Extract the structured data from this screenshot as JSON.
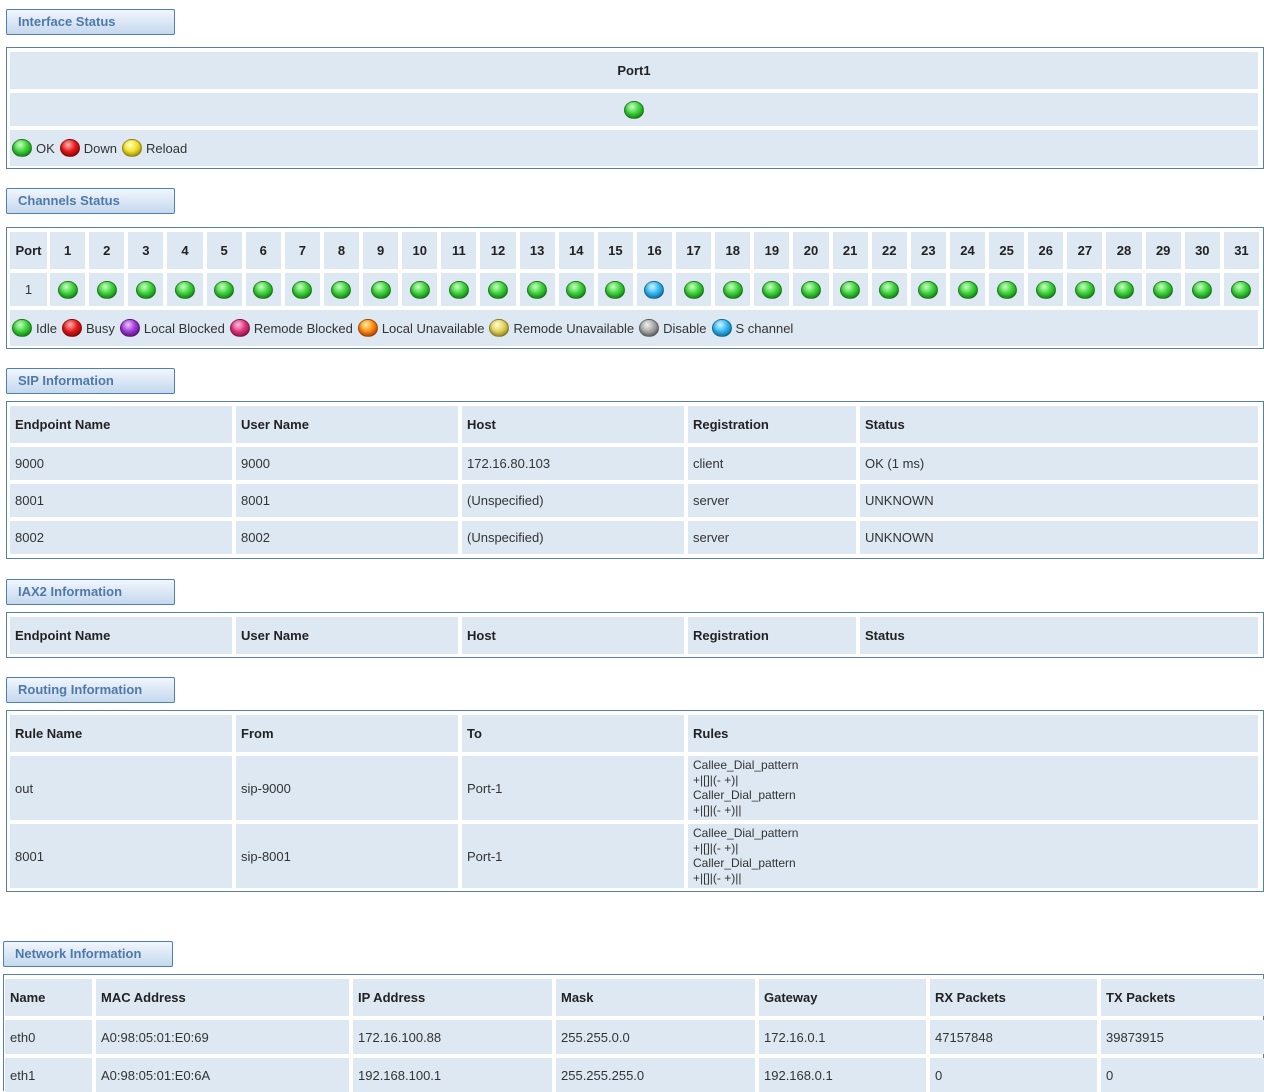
{
  "interface_status": {
    "title": "Interface Status",
    "port_header": "Port1",
    "port_state": "green",
    "legend": [
      {
        "icon": "green",
        "label": "OK"
      },
      {
        "icon": "red",
        "label": "Down"
      },
      {
        "icon": "yellow",
        "label": "Reload"
      }
    ]
  },
  "channels_status": {
    "title": "Channels Status",
    "port_label": "Port",
    "port_value": "1",
    "channels": [
      "1",
      "2",
      "3",
      "4",
      "5",
      "6",
      "7",
      "8",
      "9",
      "10",
      "11",
      "12",
      "13",
      "14",
      "15",
      "16",
      "17",
      "18",
      "19",
      "20",
      "21",
      "22",
      "23",
      "24",
      "25",
      "26",
      "27",
      "28",
      "29",
      "30",
      "31"
    ],
    "states": [
      "green",
      "green",
      "green",
      "green",
      "green",
      "green",
      "green",
      "green",
      "green",
      "green",
      "green",
      "green",
      "green",
      "green",
      "green",
      "cyan",
      "green",
      "green",
      "green",
      "green",
      "green",
      "green",
      "green",
      "green",
      "green",
      "green",
      "green",
      "green",
      "green",
      "green",
      "green"
    ],
    "legend": [
      {
        "icon": "green",
        "label": "Idle"
      },
      {
        "icon": "red",
        "label": "Busy"
      },
      {
        "icon": "purple",
        "label": "Local Blocked"
      },
      {
        "icon": "magenta",
        "label": "Remode Blocked"
      },
      {
        "icon": "orange",
        "label": "Local Unavailable"
      },
      {
        "icon": "khaki",
        "label": "Remode Unavailable"
      },
      {
        "icon": "gray",
        "label": "Disable"
      },
      {
        "icon": "cyan",
        "label": "S channel"
      }
    ]
  },
  "sip": {
    "title": "SIP Information",
    "headers": [
      "Endpoint Name",
      "User Name",
      "Host",
      "Registration",
      "Status"
    ],
    "rows": [
      [
        "9000",
        "9000",
        "172.16.80.103",
        "client",
        "OK (1 ms)"
      ],
      [
        "8001",
        "8001",
        "(Unspecified)",
        "server",
        "UNKNOWN"
      ],
      [
        "8002",
        "8002",
        "(Unspecified)",
        "server",
        "UNKNOWN"
      ]
    ]
  },
  "iax2": {
    "title": "IAX2 Information",
    "headers": [
      "Endpoint Name",
      "User Name",
      "Host",
      "Registration",
      "Status"
    ]
  },
  "routing": {
    "title": "Routing Information",
    "headers": [
      "Rule Name",
      "From",
      "To",
      "Rules"
    ],
    "rows": [
      {
        "name": "out",
        "from": "sip-9000",
        "to": "Port-1",
        "rules": [
          "Callee_Dial_pattern",
          "+|[]|(- +)|",
          "Caller_Dial_pattern",
          "+|[]|(- +)||"
        ]
      },
      {
        "name": "8001",
        "from": "sip-8001",
        "to": "Port-1",
        "rules": [
          "Callee_Dial_pattern",
          "+|[]|(- +)|",
          "Caller_Dial_pattern",
          "+|[]|(- +)||"
        ]
      }
    ]
  },
  "network": {
    "title": "Network Information",
    "headers": [
      "Name",
      "MAC Address",
      "IP Address",
      "Mask",
      "Gateway",
      "RX Packets",
      "TX Packets"
    ],
    "rows": [
      [
        "eth0",
        "A0:98:05:01:E0:69",
        "172.16.100.88",
        "255.255.0.0",
        "172.16.0.1",
        "47157848",
        "39873915"
      ],
      [
        "eth1",
        "A0:98:05:01:E0:6A",
        "192.168.100.1",
        "255.255.255.0",
        "192.168.0.1",
        "0",
        "0"
      ]
    ]
  }
}
